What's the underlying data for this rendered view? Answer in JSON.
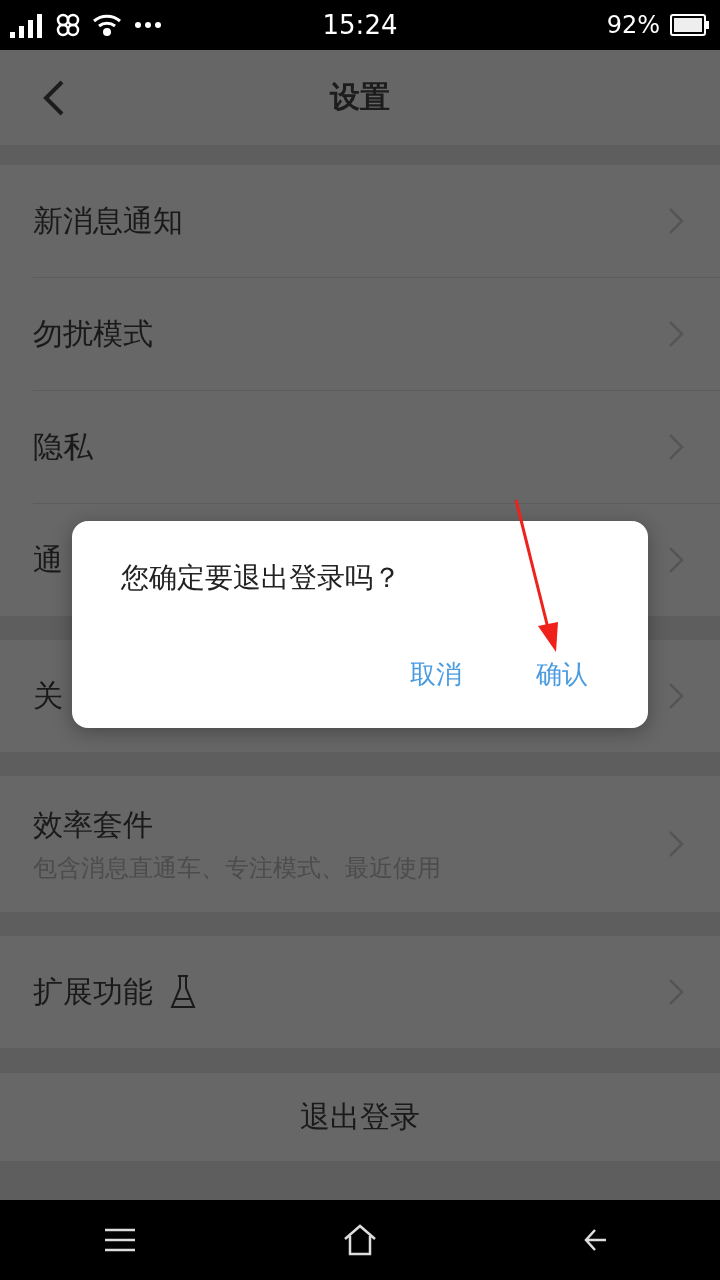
{
  "status_bar": {
    "time": "15:24",
    "battery": "92%"
  },
  "header": {
    "title": "设置"
  },
  "groups": [
    {
      "rows": [
        {
          "title": "新消息通知"
        },
        {
          "title": "勿扰模式"
        },
        {
          "title": "隐私"
        },
        {
          "title": "通"
        }
      ]
    },
    {
      "rows": [
        {
          "title": "关"
        }
      ]
    },
    {
      "rows": [
        {
          "title": "效率套件",
          "subtitle": "包含消息直通车、专注模式、最近使用"
        }
      ]
    },
    {
      "rows": [
        {
          "title": "扩展功能",
          "lab_icon": true
        }
      ]
    }
  ],
  "logout": {
    "label": "退出登录"
  },
  "dialog": {
    "message": "您确定要退出登录吗？",
    "buttons": [
      "取消",
      "确认"
    ]
  }
}
